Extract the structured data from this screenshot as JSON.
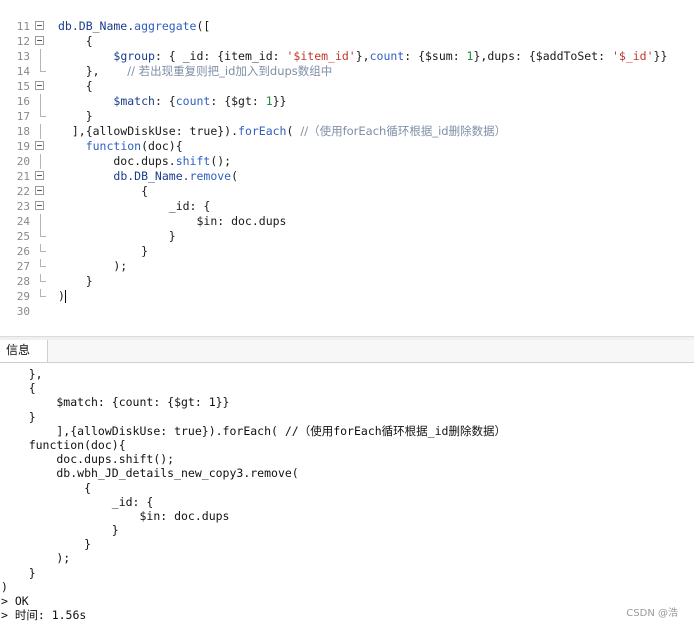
{
  "editor": {
    "lines": [
      {
        "num": "11",
        "text": ""
      },
      {
        "num": "12",
        "text": "db.DB_Name.aggregate(["
      },
      {
        "num": "13",
        "text": "    {"
      },
      {
        "num": "14",
        "text": "        $group: { _id: {item_id: '$item_id'},count: {$sum: 1},dups: {$addToSet: '$_id'}}"
      },
      {
        "num": "15",
        "text": "    },    // 若出现重复则把_id加入到dups数组中"
      },
      {
        "num": "16",
        "text": "    {"
      },
      {
        "num": "17",
        "text": "        $match: {count: {$gt: 1}}"
      },
      {
        "num": "18",
        "text": "    }"
      },
      {
        "num": "19",
        "text": "  ],{allowDiskUse: true}).forEach( //（使用forEach循环根据_id删除数据）"
      },
      {
        "num": "20",
        "text": "    function(doc){"
      },
      {
        "num": "21",
        "text": "        doc.dups.shift();"
      },
      {
        "num": "22",
        "text": "        db.DB_Name.remove("
      },
      {
        "num": "23",
        "text": "            {"
      },
      {
        "num": "24",
        "text": "                _id: {"
      },
      {
        "num": "25",
        "text": "                    $in: doc.dups"
      },
      {
        "num": "26",
        "text": "                }"
      },
      {
        "num": "27",
        "text": "            }"
      },
      {
        "num": "28",
        "text": "        );"
      },
      {
        "num": "29",
        "text": "    }"
      },
      {
        "num": "30",
        "text": ")"
      }
    ]
  },
  "tabs": {
    "info_label": "信息"
  },
  "output": {
    "lines": [
      "    },",
      "    {",
      "        $match: {count: {$gt: 1}}",
      "    }",
      "        ],{allowDiskUse: true}).forEach( //（使用forEach循环根据_id删除数据）",
      "    function(doc){",
      "        doc.dups.shift();",
      "        db.wbh_JD_details_new_copy3.remove(",
      "            {",
      "                _id: {",
      "                    $in: doc.dups",
      "                }",
      "            }",
      "        );",
      "    }",
      ")",
      "> OK",
      "> 时间: 1.56s"
    ]
  },
  "watermark": "CSDN @浩"
}
